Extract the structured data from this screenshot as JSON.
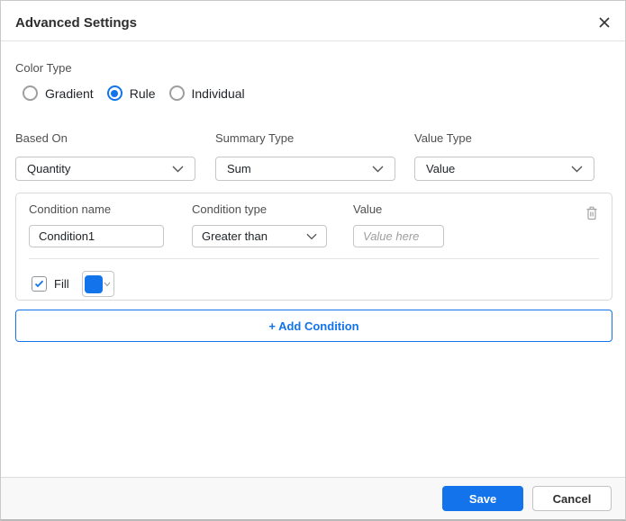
{
  "header": {
    "title": "Advanced Settings",
    "close_icon": "close"
  },
  "color_type": {
    "label": "Color Type",
    "options": [
      {
        "label": "Gradient",
        "selected": false
      },
      {
        "label": "Rule",
        "selected": true
      },
      {
        "label": "Individual",
        "selected": false
      }
    ]
  },
  "based_on": {
    "label": "Based On",
    "value": "Quantity"
  },
  "summary_type": {
    "label": "Summary Type",
    "value": "Sum"
  },
  "value_type": {
    "label": "Value Type",
    "value": "Value"
  },
  "condition": {
    "name_label": "Condition name",
    "name_value": "Condition1",
    "type_label": "Condition type",
    "type_value": "Greater than",
    "value_label": "Value",
    "value_placeholder": "Value here",
    "fill_label": "Fill",
    "fill_checked": true,
    "fill_color": "#1273eb",
    "delete_icon": "trash"
  },
  "add_condition": {
    "label": "+ Add Condition"
  },
  "footer": {
    "save_label": "Save",
    "cancel_label": "Cancel"
  },
  "colors": {
    "primary": "#1273eb",
    "border": "#c6c6c6",
    "panel_border": "#d9d9d9",
    "footer_bg": "#f8f8f8"
  }
}
